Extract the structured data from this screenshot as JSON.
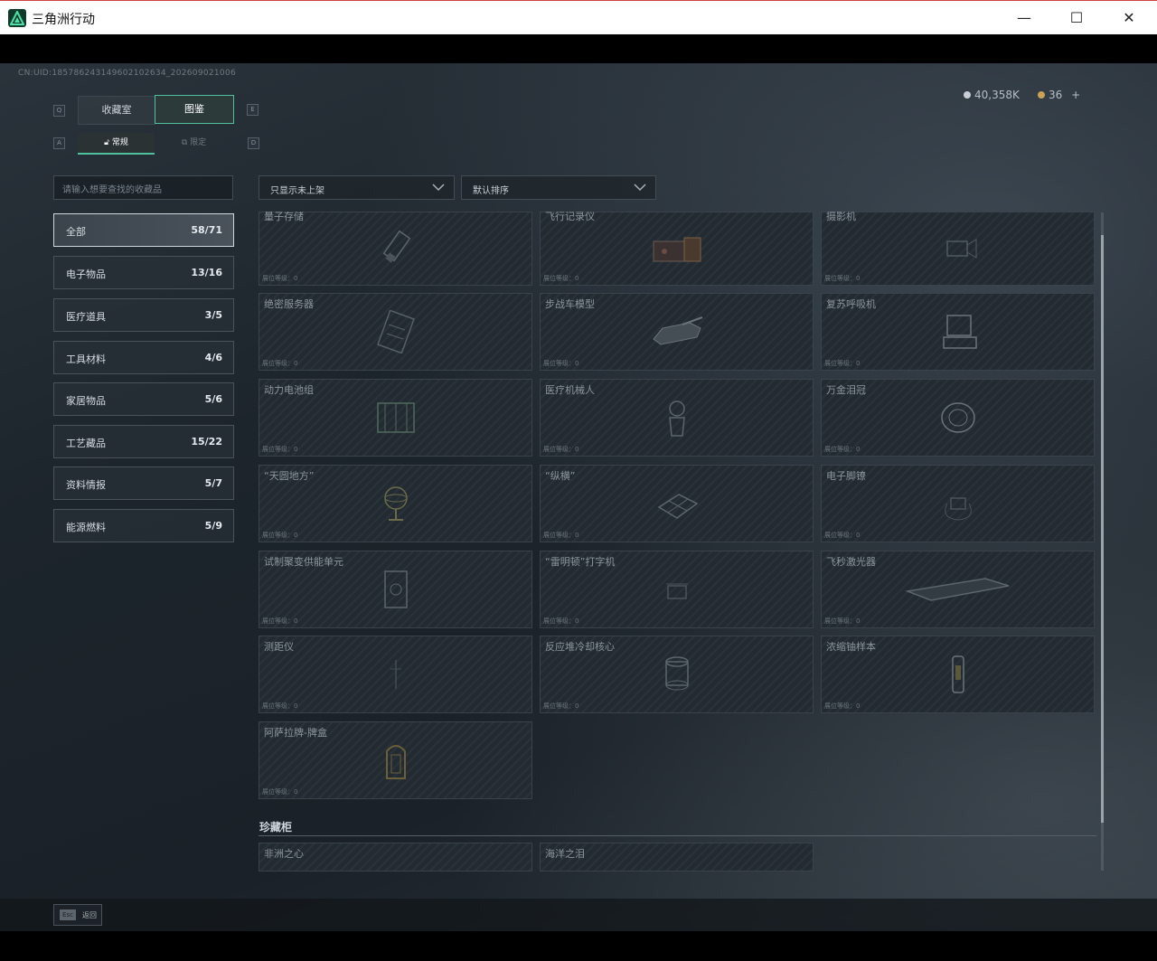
{
  "window": {
    "title": "三角洲行动"
  },
  "header": {
    "uid": "CN:UID:185786243149602102634_202609021006",
    "silver_amount": "40,358K",
    "gold_amount": "36",
    "plus_label": "+"
  },
  "tabs": [
    {
      "label": "收藏室",
      "key": "Q"
    },
    {
      "label": "图鉴",
      "key": "E"
    }
  ],
  "subtabs": {
    "left_key": "A",
    "right_key": "D",
    "items": [
      {
        "label": "常规"
      },
      {
        "label": "限定"
      }
    ]
  },
  "search": {
    "placeholder": "请输入想要查找的收藏品"
  },
  "categories": [
    {
      "name": "全部",
      "count": "58/71"
    },
    {
      "name": "电子物品",
      "count": "13/16"
    },
    {
      "name": "医疗道具",
      "count": "3/5"
    },
    {
      "name": "工具材料",
      "count": "4/6"
    },
    {
      "name": "家居物品",
      "count": "5/6"
    },
    {
      "name": "工艺藏品",
      "count": "15/22"
    },
    {
      "name": "资料情报",
      "count": "5/7"
    },
    {
      "name": "能源燃料",
      "count": "5/9"
    }
  ],
  "filters": {
    "show_filter": "只显示未上架",
    "sort": "默认排序"
  },
  "items": [
    {
      "name": "量子存储",
      "level": "展位等级：0"
    },
    {
      "name": "飞行记录仪",
      "level": "展位等级：0"
    },
    {
      "name": "摄影机",
      "level": "展位等级：0"
    },
    {
      "name": "绝密服务器",
      "level": "展位等级：0"
    },
    {
      "name": "步战车模型",
      "level": "展位等级：0"
    },
    {
      "name": "复苏呼吸机",
      "level": "展位等级：0"
    },
    {
      "name": "动力电池组",
      "level": "展位等级：0"
    },
    {
      "name": "医疗机械人",
      "level": "展位等级：0"
    },
    {
      "name": "万金泪冠",
      "level": "展位等级：0"
    },
    {
      "name": "“天圆地方”",
      "level": "展位等级：0"
    },
    {
      "name": "“纵横”",
      "level": "展位等级：0"
    },
    {
      "name": "电子脚镣",
      "level": "展位等级：0"
    },
    {
      "name": "试制聚变供能单元",
      "level": "展位等级：0"
    },
    {
      "name": "“雷明顿”打字机",
      "level": "展位等级：0"
    },
    {
      "name": "飞秒激光器",
      "level": "展位等级：0"
    },
    {
      "name": "测距仪",
      "level": "展位等级：0"
    },
    {
      "name": "反应堆冷却核心",
      "level": "展位等级：0"
    },
    {
      "name": "浓缩铀样本",
      "level": "展位等级：0"
    },
    {
      "name": "阿萨拉牌-牌盒",
      "level": "展位等级：0"
    }
  ],
  "rare_section": {
    "title": "珍藏柜",
    "items": [
      {
        "name": "非洲之心"
      },
      {
        "name": "海洋之泪"
      }
    ]
  },
  "footer": {
    "esc_key": "Esc",
    "esc_label": "返回"
  },
  "colors": {
    "accent": "#4fbf9d",
    "background": "#1d252c"
  }
}
